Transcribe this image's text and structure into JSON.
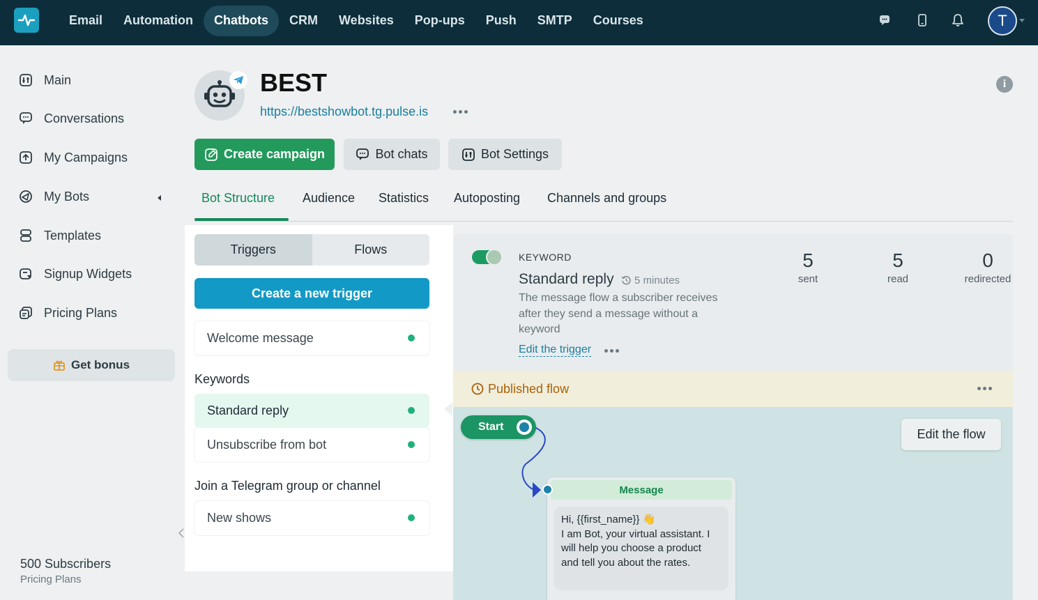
{
  "topnav": {
    "items": [
      "Email",
      "Automation",
      "Chatbots",
      "CRM",
      "Websites",
      "Pop-ups",
      "Push",
      "SMTP",
      "Courses"
    ],
    "active": "Chatbots",
    "avatar_letter": "T",
    "icons": [
      "chat-icon",
      "mobile-icon",
      "bell-icon"
    ]
  },
  "sidebar": {
    "items": [
      {
        "label": "Main",
        "icon": "dashboard-icon"
      },
      {
        "label": "Conversations",
        "icon": "chat-icon"
      },
      {
        "label": "My Campaigns",
        "icon": "campaign-icon"
      },
      {
        "label": "My Bots",
        "icon": "bot-icon"
      },
      {
        "label": "Templates",
        "icon": "templates-icon"
      },
      {
        "label": "Signup Widgets",
        "icon": "widget-icon"
      },
      {
        "label": "Pricing Plans",
        "icon": "pricing-icon"
      }
    ],
    "bonus_label": "Get bonus",
    "subscribers": "500 Subscribers",
    "plans_link": "Pricing Plans"
  },
  "bot": {
    "name": "BEST",
    "url": "https://bestshowbot.tg.pulse.is"
  },
  "actions": {
    "create_campaign": "Create campaign",
    "bot_chats": "Bot chats",
    "bot_settings": "Bot Settings"
  },
  "tabs": [
    "Bot Structure",
    "Audience",
    "Statistics",
    "Autoposting",
    "Channels and groups"
  ],
  "panel": {
    "segments": [
      "Triggers",
      "Flows"
    ],
    "create_trigger": "Create a new trigger",
    "welcome": "Welcome message",
    "keywords_label": "Keywords",
    "keywords": [
      "Standard reply",
      "Unsubscribe from bot"
    ],
    "join_label": "Join a Telegram group or channel",
    "join_items": [
      "New shows"
    ]
  },
  "trigger": {
    "type": "KEYWORD",
    "name": "Standard reply",
    "delay": "5 minutes",
    "description": "The message flow a subscriber receives after they send a message without a keyword",
    "edit_link": "Edit the trigger",
    "stats": [
      {
        "value": "5",
        "label": "sent"
      },
      {
        "value": "5",
        "label": "read"
      },
      {
        "value": "0",
        "label": "redirected"
      }
    ],
    "published": "Published flow"
  },
  "flow": {
    "start_label": "Start",
    "edit_flow": "Edit the flow",
    "message_title": "Message",
    "message_text": "Hi,  {{first_name}} 👋\nI am Bot, your virtual assistant. I will help you choose a product and tell you about the rates."
  },
  "colors": {
    "nav_bg": "#0c2d39",
    "accent_green": "#239a5c",
    "accent_blue": "#1399c6",
    "link": "#1a7ea0",
    "published_text": "#a8620a"
  }
}
